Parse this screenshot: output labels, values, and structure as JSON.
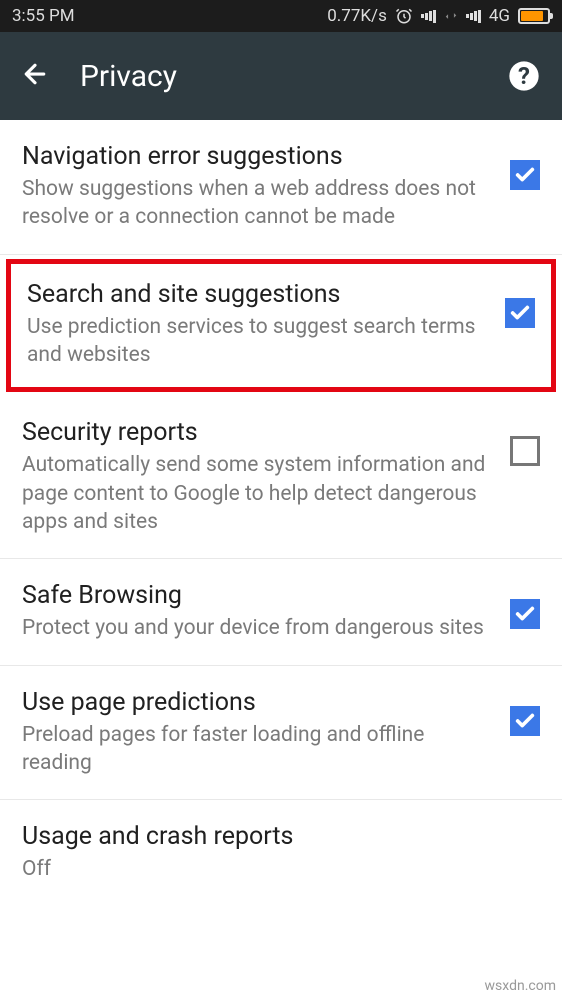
{
  "status": {
    "time": "3:55 PM",
    "speed": "0.77K/s",
    "network": "4G"
  },
  "appbar": {
    "title": "Privacy"
  },
  "settings": [
    {
      "title": "Navigation error suggestions",
      "desc": "Show suggestions when a web address does not resolve or a connection cannot be made",
      "checked": true,
      "highlighted": false
    },
    {
      "title": "Search and site suggestions",
      "desc": "Use prediction services to suggest search terms and websites",
      "checked": true,
      "highlighted": true
    },
    {
      "title": "Security reports",
      "desc": "Automatically send some system information and page content to Google to help detect dangerous apps and sites",
      "checked": false,
      "highlighted": false
    },
    {
      "title": "Safe Browsing",
      "desc": "Protect you and your device from dangerous sites",
      "checked": true,
      "highlighted": false
    },
    {
      "title": "Use page predictions",
      "desc": "Preload pages for faster loading and offline reading",
      "checked": true,
      "highlighted": false
    },
    {
      "title": "Usage and crash reports",
      "desc": "Off",
      "checked": null,
      "highlighted": false
    }
  ],
  "watermark": "wsxdn.com"
}
